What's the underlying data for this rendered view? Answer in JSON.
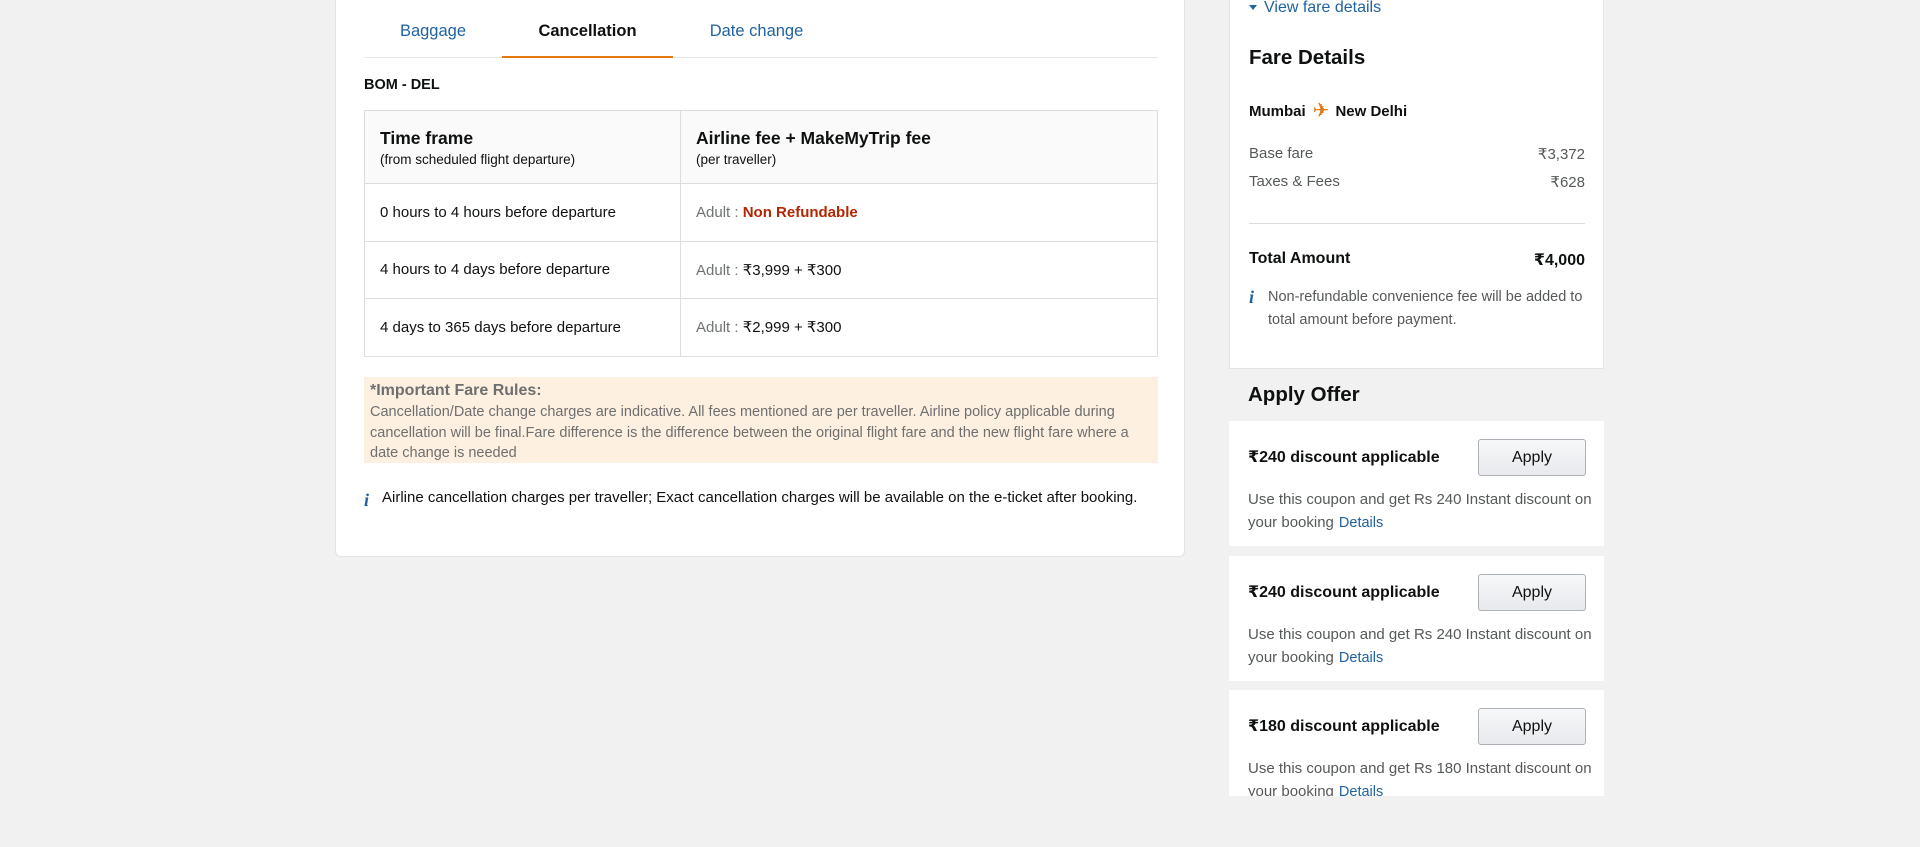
{
  "tabs": {
    "baggage": "Baggage",
    "cancellation": "Cancellation",
    "date_change": "Date change"
  },
  "route": "BOM - DEL",
  "table": {
    "col1_title": "Time frame",
    "col1_sub": "(from scheduled flight departure)",
    "col2_title": "Airline fee + MakeMyTrip fee",
    "col2_sub": "(per traveller)",
    "rows": [
      {
        "time": "0 hours to 4 hours before departure",
        "prefix": "Adult :",
        "fee": "Non Refundable"
      },
      {
        "time": "4 hours to 4 days before departure",
        "prefix": "Adult :",
        "fee": "₹3,999 + ₹300"
      },
      {
        "time": "4 days to 365 days before departure",
        "prefix": "Adult :",
        "fee": "₹2,999 + ₹300"
      }
    ]
  },
  "rules": {
    "title": "*Important Fare Rules:",
    "text": "Cancellation/Date change charges are indicative. All fees mentioned are per traveller. Airline policy applicable during cancellation will be final.Fare difference is the difference between the original flight fare and the new flight fare where a date change is needed"
  },
  "note": "Airline cancellation charges per traveller; Exact cancellation charges will be available on the e-ticket after booking.",
  "fare": {
    "view_link": "View fare details",
    "title": "Fare Details",
    "from": "Mumbai",
    "to": "New Delhi",
    "base_label": "Base fare",
    "base_value": "₹3,372",
    "taxes_label": "Taxes & Fees",
    "taxes_value": "₹628",
    "total_label": "Total Amount",
    "total_value": "₹4,000",
    "fee_note": "Non-refundable convenience fee will be added to total amount before payment."
  },
  "offers": {
    "title": "Apply Offer",
    "apply_label": "Apply",
    "details_label": "Details",
    "items": [
      {
        "label": "₹240 discount applicable",
        "desc": "Use this coupon and get Rs 240 Instant discount on your booking"
      },
      {
        "label": "₹240 discount applicable",
        "desc": "Use this coupon and get Rs 240 Instant discount on your booking"
      },
      {
        "label": "₹180 discount applicable",
        "desc": "Use this coupon and get Rs 180 Instant discount on your booking"
      }
    ]
  },
  "colors": {
    "link": "#2162a1",
    "accent": "#e47911",
    "non_refundable": "#b12704",
    "rules_bg": "#fdf0e1"
  }
}
